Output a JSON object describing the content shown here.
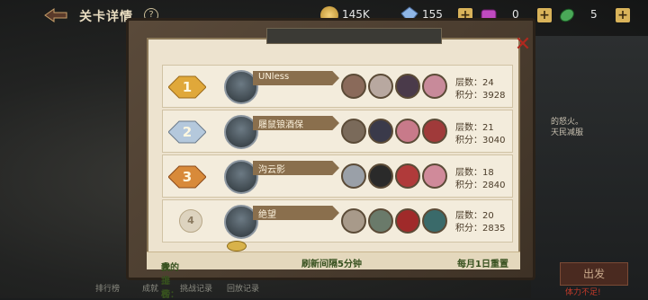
{
  "header": {
    "title": "关卡详情",
    "hint_symbol": "?",
    "resources": [
      {
        "name": "coin",
        "icon": "coin-icon",
        "value": "145K",
        "color": "#d8b24a"
      },
      {
        "name": "diamond",
        "icon": "diamond-icon",
        "value": "155",
        "color": "#7fa6d8"
      },
      {
        "name": "ticket",
        "icon": "ticket-icon",
        "value": "0",
        "color": "#c04ac0"
      },
      {
        "name": "leaf",
        "icon": "leaf-icon",
        "value": "5",
        "color": "#4aa858"
      }
    ],
    "plus_symbol": "+"
  },
  "panel": {
    "close_symbol": "✕",
    "rows": [
      {
        "rank": "1",
        "name": "UNless",
        "floors_label": "层数：",
        "floors": "24",
        "score_label": "积分：",
        "score": "3928",
        "medal_color": "#e0a83a"
      },
      {
        "rank": "2",
        "name": "屦鼠锒酒保",
        "floors_label": "层数：",
        "floors": "21",
        "score_label": "积分：",
        "score": "3040",
        "medal_color": "#9fb4cc"
      },
      {
        "rank": "3",
        "name": "沟云影",
        "floors_label": "层数：",
        "floors": "18",
        "score_label": "积分：",
        "score": "2840",
        "medal_color": "#d0823a"
      },
      {
        "rank": "4",
        "name": "绝望",
        "floors_label": "层数：",
        "floors": "20",
        "score_label": "积分：",
        "score": "2835",
        "medal_color": "#c8c0b0"
      }
    ]
  },
  "footer": {
    "my_rank_label": "我的排名：",
    "my_rank_value": "未上榜",
    "refresh": "刷新间隔5分钟",
    "reset": "每月1日重置"
  },
  "side": {
    "line1": "的怒火。",
    "line2": "天民减服",
    "action": "出发",
    "cost": "体力不足!"
  },
  "bottom_tabs": [
    "排行榜",
    "成就",
    "挑战记录",
    "回放记录"
  ]
}
